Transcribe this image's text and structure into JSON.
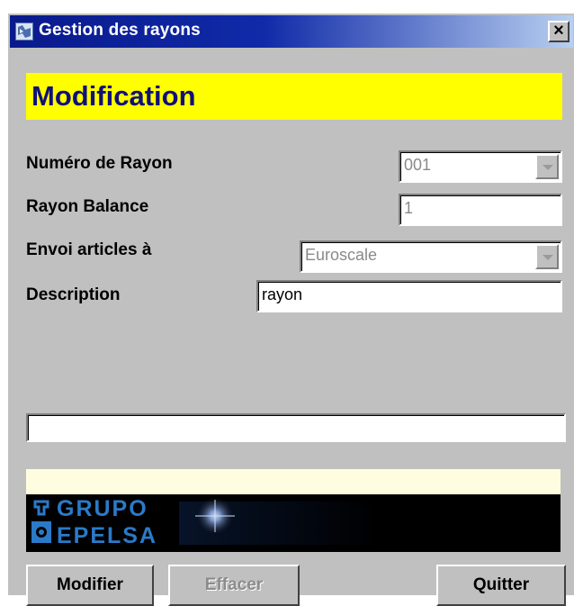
{
  "window": {
    "title": "Gestion des rayons",
    "close_glyph": "×"
  },
  "mode": {
    "title": "Modification",
    "banner_color": "#ffff00"
  },
  "fields": {
    "numero_rayon": {
      "label": "Numéro de Rayon",
      "value": "001",
      "enabled": false
    },
    "rayon_balance": {
      "label": "Rayon Balance",
      "value": "1",
      "enabled": false
    },
    "envoi_articles": {
      "label": "Envoi articles à",
      "value": "Euroscale",
      "enabled": false
    },
    "description": {
      "label": "Description",
      "value": "rayon",
      "enabled": true
    }
  },
  "message_field": {
    "value": ""
  },
  "logo": {
    "line1": "GRUPO",
    "line2": "EPELSA"
  },
  "buttons": {
    "modifier": {
      "label": "Modifier",
      "enabled": true
    },
    "effacer": {
      "label": "Effacer",
      "enabled": false
    },
    "quitter": {
      "label": "Quitter",
      "enabled": true
    }
  },
  "icons": {
    "app": "app-window-icon",
    "close": "close-icon",
    "dropdown": "chevron-down-icon",
    "logo": "scale-logo-icon"
  }
}
